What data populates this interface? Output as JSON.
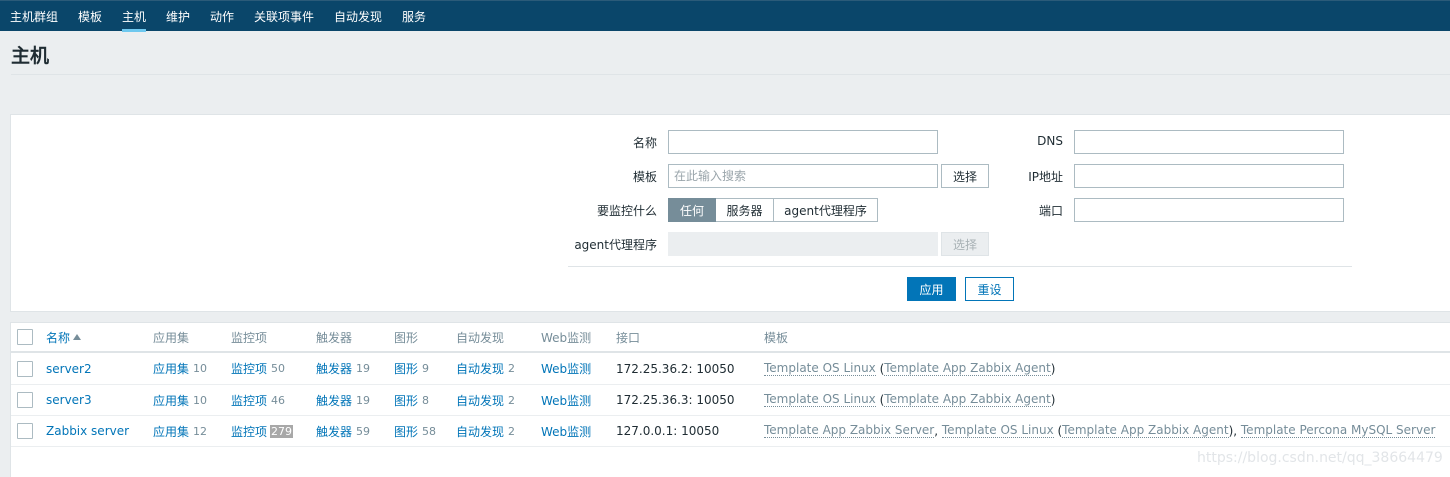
{
  "nav": {
    "items": [
      {
        "label": "主机群组",
        "active": false
      },
      {
        "label": "模板",
        "active": false
      },
      {
        "label": "主机",
        "active": true
      },
      {
        "label": "维护",
        "active": false
      },
      {
        "label": "动作",
        "active": false
      },
      {
        "label": "关联项事件",
        "active": false
      },
      {
        "label": "自动发现",
        "active": false
      },
      {
        "label": "服务",
        "active": false
      }
    ]
  },
  "page_title": "主机",
  "filter": {
    "name_label": "名称",
    "name_value": "",
    "template_label": "模板",
    "template_placeholder": "在此输入搜索",
    "template_select": "选择",
    "monitored_by_label": "要监控什么",
    "monitored_by_options": [
      "任何",
      "服务器",
      "agent代理程序"
    ],
    "monitored_by_selected": "任何",
    "proxy_label": "agent代理程序",
    "proxy_select": "选择",
    "dns_label": "DNS",
    "ip_label": "IP地址",
    "port_label": "端口",
    "apply": "应用",
    "reset": "重设"
  },
  "table": {
    "headers": {
      "name": "名称",
      "applications": "应用集",
      "items": "监控项",
      "triggers": "触发器",
      "graphs": "图形",
      "discovery": "自动发现",
      "web": "Web监测",
      "interface": "接口",
      "templates": "模板"
    },
    "rows": [
      {
        "name": "server2",
        "applications": "应用集",
        "applications_count": "10",
        "items": "监控项",
        "items_count": "50",
        "triggers": "触发器",
        "triggers_count": "19",
        "graphs": "图形",
        "graphs_count": "9",
        "discovery": "自动发现",
        "discovery_count": "2",
        "web": "Web监测",
        "interface": "172.25.36.2: 10050",
        "tpl1": "Template OS Linux",
        "open": " (",
        "tpl2": "Template App Zabbix Agent",
        "close": ")"
      },
      {
        "name": "server3",
        "applications": "应用集",
        "applications_count": "10",
        "items": "监控项",
        "items_count": "46",
        "triggers": "触发器",
        "triggers_count": "19",
        "graphs": "图形",
        "graphs_count": "8",
        "discovery": "自动发现",
        "discovery_count": "2",
        "web": "Web监测",
        "interface": "172.25.36.3: 10050",
        "tpl1": "Template OS Linux",
        "open": " (",
        "tpl2": "Template App Zabbix Agent",
        "close": ")"
      },
      {
        "name": "Zabbix server",
        "applications": "应用集",
        "applications_count": "12",
        "items": "监控项",
        "items_count": "279",
        "triggers": "触发器",
        "triggers_count": "59",
        "graphs": "图形",
        "graphs_count": "58",
        "discovery": "自动发现",
        "discovery_count": "2",
        "web": "Web监测",
        "interface": "127.0.0.1: 10050",
        "tpl1": "Template App Zabbix Server",
        "sep1": ", ",
        "tpl2": "Template OS Linux",
        "open": " (",
        "tpl3": "Template App Zabbix Agent",
        "close": "), ",
        "tpl4": "Template Percona MySQL Server"
      }
    ]
  },
  "watermark": "https://blog.csdn.net/qq_38664479"
}
